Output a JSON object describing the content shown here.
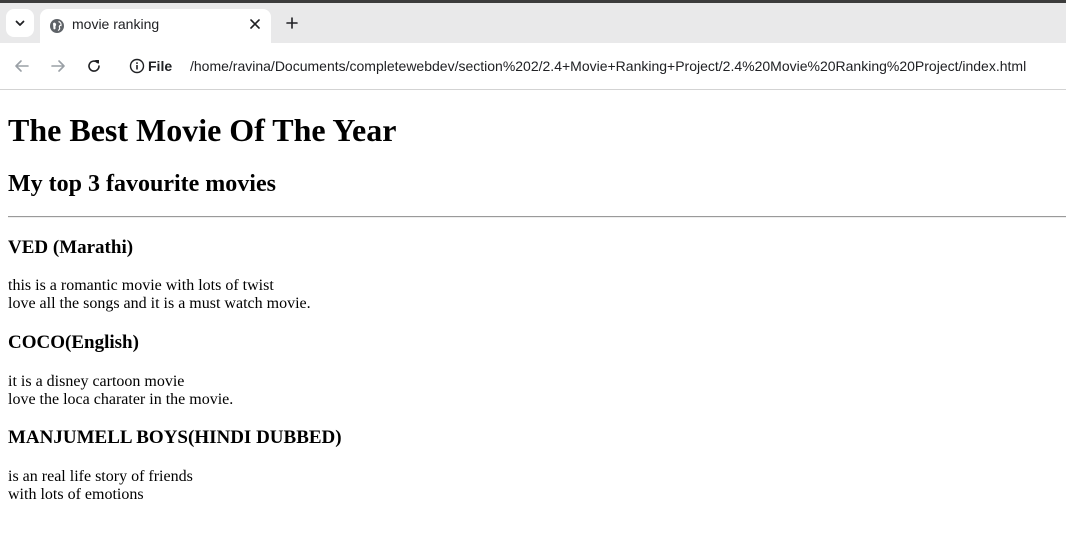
{
  "browser": {
    "tab": {
      "title": "movie ranking"
    },
    "address_bar": {
      "scheme_label": "File",
      "url": "/home/ravina/Documents/completewebdev/section%202/2.4+Movie+Ranking+Project/2.4%20Movie%20Ranking%20Project/index.html"
    }
  },
  "page": {
    "heading": "The Best Movie Of The Year",
    "subheading": "My top 3 favourite movies",
    "movies": [
      {
        "title": "VED (Marathi)",
        "line1": "this is a romantic movie with lots of twist",
        "line2": "love all the songs and it is a must watch movie."
      },
      {
        "title": "COCO(English)",
        "line1": "it is a disney cartoon movie",
        "line2": "love the loca charater in the movie."
      },
      {
        "title": "MANJUMELL BOYS(HINDI DUBBED)",
        "line1": "is an real life story of friends",
        "line2": "with lots of emotions"
      }
    ]
  },
  "icons": {
    "tab_search": "chevron-down-icon",
    "favicon": "globe-icon",
    "tab_close": "close-icon",
    "new_tab": "plus-icon",
    "back": "arrow-left-icon",
    "forward": "arrow-right-icon",
    "reload": "reload-icon",
    "site_info": "info-icon"
  },
  "colors": {
    "tabstrip_bg": "#e9e9ea",
    "text": "#000000",
    "disabled_icon": "#9aa0a6"
  }
}
